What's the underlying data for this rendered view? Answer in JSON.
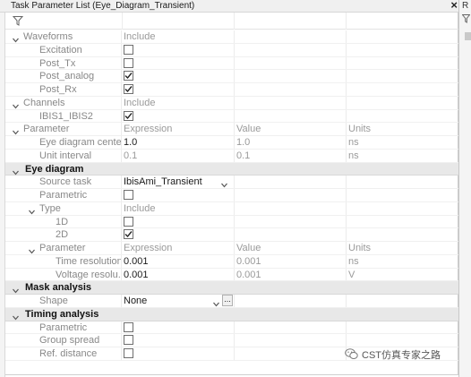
{
  "window": {
    "title": "Task Parameter List (Eye_Diagram_Transient)",
    "right_title": "R"
  },
  "rows": [
    {
      "type": "group",
      "level": 0,
      "label": "Waveforms",
      "c1": "Include",
      "expanded": true
    },
    {
      "type": "check",
      "level": 1,
      "label": "Excitation",
      "checked": false
    },
    {
      "type": "check",
      "level": 1,
      "label": "Post_Tx",
      "checked": false
    },
    {
      "type": "check",
      "level": 1,
      "label": "Post_analog",
      "checked": true
    },
    {
      "type": "check",
      "level": 1,
      "label": "Post_Rx",
      "checked": true
    },
    {
      "type": "group",
      "level": 0,
      "label": "Channels",
      "c1": "Include",
      "expanded": true
    },
    {
      "type": "check",
      "level": 1,
      "label": "IBIS1_IBIS2",
      "checked": true
    },
    {
      "type": "group",
      "level": 0,
      "label": "Parameter",
      "c1": "Expression",
      "c2": "Value",
      "c3": "Units",
      "expanded": true
    },
    {
      "type": "value",
      "level": 1,
      "label": "Eye diagram center",
      "c1": "1.0",
      "c2": "1.0",
      "c3": "ns",
      "editable": true
    },
    {
      "type": "value",
      "level": 1,
      "label": "Unit interval",
      "c1": "0.1",
      "c2": "0.1",
      "c3": "ns",
      "editable": false
    },
    {
      "type": "header",
      "label": "Eye diagram"
    },
    {
      "type": "dropdown",
      "level": 1,
      "label": "Source task",
      "value": "IbisAmi_Transient"
    },
    {
      "type": "check",
      "level": 1,
      "label": "Parametric",
      "checked": false
    },
    {
      "type": "group",
      "level": 1,
      "label": "Type",
      "c1": "Include",
      "expanded": true
    },
    {
      "type": "check",
      "level": 2,
      "label": "1D",
      "checked": false
    },
    {
      "type": "check",
      "level": 2,
      "label": "2D",
      "checked": true
    },
    {
      "type": "group",
      "level": 1,
      "label": "Parameter",
      "c1": "Expression",
      "c2": "Value",
      "c3": "Units",
      "expanded": true
    },
    {
      "type": "value",
      "level": 2,
      "label": "Time resolution",
      "c1": "0.001",
      "c2": "0.001",
      "c3": "ns",
      "editable": true,
      "darklabel": true
    },
    {
      "type": "value",
      "level": 2,
      "label": "Voltage resolu...",
      "c1": "0.001",
      "c2": "0.001",
      "c3": "V",
      "editable": true
    },
    {
      "type": "header",
      "label": "Mask analysis"
    },
    {
      "type": "dropdown2",
      "level": 1,
      "label": "Shape",
      "value": "None",
      "ellipsis": "..."
    },
    {
      "type": "header",
      "label": "Timing analysis"
    },
    {
      "type": "check",
      "level": 1,
      "label": "Parametric",
      "checked": false
    },
    {
      "type": "check",
      "level": 1,
      "label": "Group spread",
      "checked": false
    },
    {
      "type": "check",
      "level": 1,
      "label": "Ref. distance",
      "checked": false
    }
  ],
  "watermark": {
    "text": "CST仿真专家之路",
    "icon": "wechat-icon"
  },
  "colors": {
    "header_bg": "#e8e8e8",
    "grid_line": "#ececec",
    "muted_text": "#888888"
  }
}
